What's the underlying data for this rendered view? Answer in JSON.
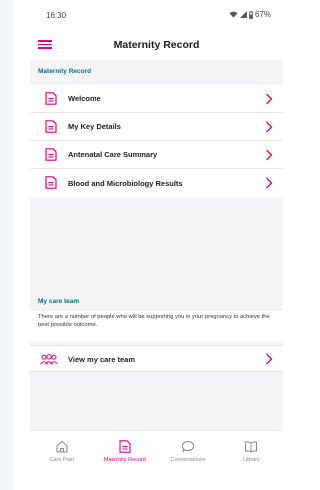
{
  "status_bar": {
    "time": "16:30",
    "battery": "67%"
  },
  "header": {
    "title": "Maternity Record"
  },
  "maternity_section": {
    "title": "Maternity Record",
    "items": [
      {
        "label": "Welcome"
      },
      {
        "label": "My Key Details"
      },
      {
        "label": "Antenatal Care Summary"
      },
      {
        "label": "Blood and Microbiology Results"
      }
    ]
  },
  "care_team": {
    "title": "My care team",
    "description": "There are a number of people who will be supporting you in your pregnancy to achieve the best possible outcome.",
    "link_label": "View my care team"
  },
  "bottom_nav": {
    "items": [
      {
        "label": "Care Plan",
        "icon": "home-icon"
      },
      {
        "label": "Maternity Record",
        "icon": "document-icon",
        "active": true
      },
      {
        "label": "Conversations",
        "icon": "chat-bubble-icon"
      },
      {
        "label": "Library",
        "icon": "book-icon"
      }
    ]
  },
  "colors": {
    "accent": "#e6007e",
    "section_title": "#0a6c86",
    "background": "#f4f4f6"
  }
}
